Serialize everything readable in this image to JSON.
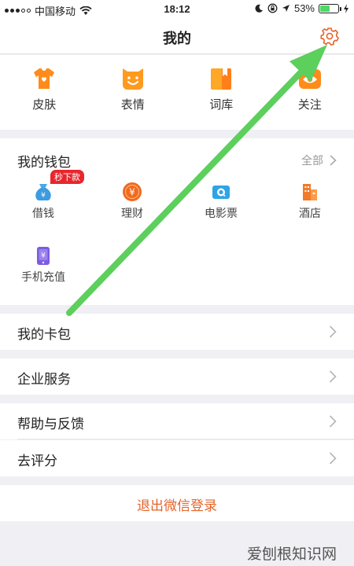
{
  "status_bar": {
    "carrier": "中国移动",
    "time": "18:12",
    "battery": "53%",
    "battery_level": 0.53,
    "icons": [
      "signal-icon",
      "wifi-icon",
      "moon-icon",
      "lock-rotation-icon",
      "location-icon",
      "battery-icon",
      "charging-icon"
    ]
  },
  "nav": {
    "title": "我的",
    "settings_icon": "gear-icon"
  },
  "quick_actions": [
    {
      "label": "皮肤",
      "icon": "tshirt-icon"
    },
    {
      "label": "表情",
      "icon": "smile-icon"
    },
    {
      "label": "词库",
      "icon": "book-icon"
    },
    {
      "label": "关注",
      "icon": "eye-icon"
    }
  ],
  "wallet": {
    "title": "我的钱包",
    "all_label": "全部",
    "badge": "秒下款",
    "items": [
      {
        "label": "借钱",
        "icon": "money-bag-icon"
      },
      {
        "label": "理财",
        "icon": "yuan-coin-icon"
      },
      {
        "label": "电影票",
        "icon": "movie-ticket-icon"
      },
      {
        "label": "酒店",
        "icon": "hotel-icon"
      },
      {
        "label": "手机充值",
        "icon": "phone-recharge-icon"
      }
    ]
  },
  "menu": [
    {
      "label": "我的卡包"
    },
    {
      "label": "企业服务"
    },
    {
      "label": "帮助与反馈"
    },
    {
      "label": "去评分"
    }
  ],
  "logout_label": "退出微信登录",
  "watermark": "爱刨根知识网",
  "colors": {
    "accent": "#ff8c1a",
    "logout": "#e5632a",
    "badge": "#e8262e",
    "annotation_arrow": "#5ccf5c"
  }
}
